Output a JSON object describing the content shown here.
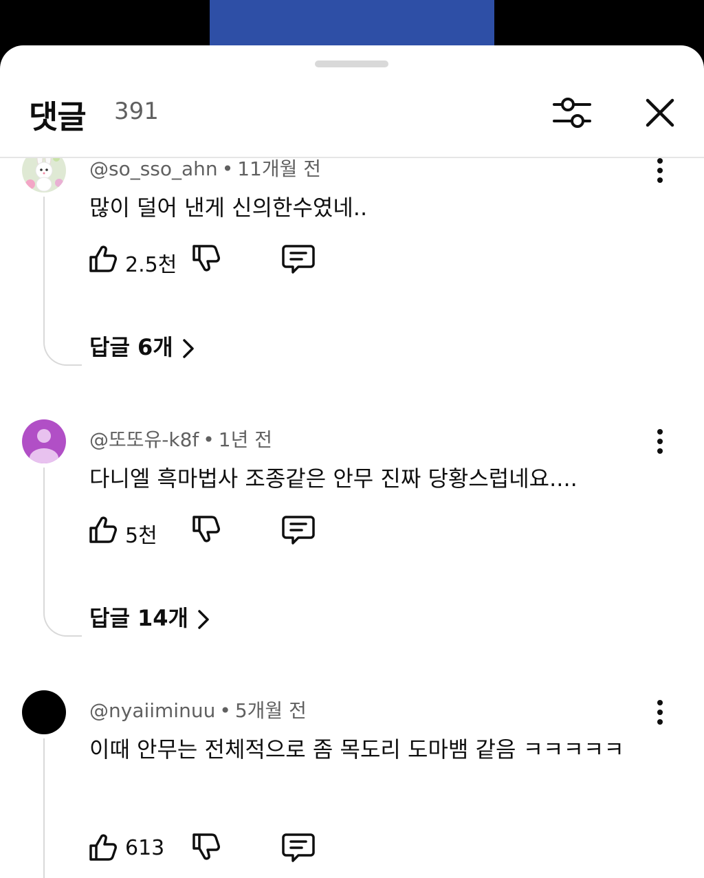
{
  "header": {
    "title": "댓글",
    "count": "391"
  },
  "comments": [
    {
      "author": "@so_sso_ahn",
      "time": "11개월 전",
      "text": "많이 덜어 낸게 신의한수였네..",
      "likes": "2.5천",
      "replies_label": "답글 6개",
      "avatar": "bunny-avatar"
    },
    {
      "author": "@또또유-k8f",
      "time": "1년 전",
      "text": "다니엘 흑마법사 조종같은 안무 진짜 당황스럽네요....",
      "likes": "5천",
      "replies_label": "답글 14개",
      "avatar": "default-person-avatar"
    },
    {
      "author": "@nyaiiminuu",
      "time": "5개월 전",
      "text": "이때 안무는 전체적으로 좀 목도리 도마뱀 같음 ㅋㅋㅋㅋㅋ",
      "likes": "613",
      "avatar": "black-avatar"
    }
  ],
  "colors": {
    "video_frame": "#2e4fa6",
    "default_avatar": "#b14fc6",
    "secondary_text": "#606060"
  }
}
